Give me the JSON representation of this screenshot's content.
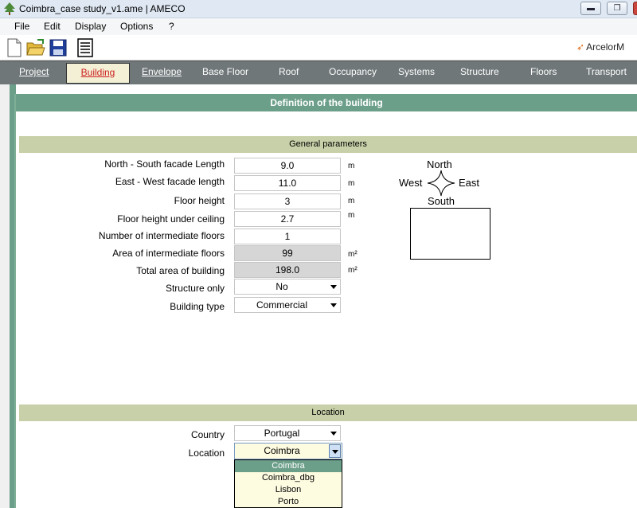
{
  "window": {
    "title": "Coimbra_case study_v1.ame | AMECO",
    "min": "▬",
    "max": "❐"
  },
  "menu": [
    "File",
    "Edit",
    "Display",
    "Options",
    "?"
  ],
  "toolbar": {
    "icons": [
      "new-document-icon",
      "open-folder-icon",
      "save-floppy-icon",
      "report-icon"
    ],
    "brand": "ArcelorM"
  },
  "tabs": {
    "active": "Building",
    "items": [
      "Project",
      "Building",
      "Envelope",
      "Base Floor",
      "Roof",
      "Occupancy",
      "Systems",
      "Structure",
      "Floors",
      "Transport"
    ]
  },
  "page": {
    "header": "Definition of the building",
    "general": {
      "title": "General parameters",
      "ns_label": "North - South facade Length",
      "ns_value": "9.0",
      "ns_unit": "m",
      "ew_label": "East - West facade length",
      "ew_value": "11.0",
      "ew_unit": "m",
      "fh_label": "Floor height",
      "fh_value": "3",
      "fh_unit": "m",
      "fhu_label": "Floor height under ceiling",
      "fhu_value": "2.7",
      "fhu_unit": "m",
      "nif_label": "Number of intermediate floors",
      "nif_value": "1",
      "aif_label": "Area of intermediate floors",
      "aif_value": "99",
      "aif_unit": "m²",
      "tab_label": "Total area of building",
      "tab_value": "198.0",
      "tab_unit": "m²",
      "so_label": "Structure only",
      "so_value": "No",
      "bt_label": "Building type",
      "bt_value": "Commercial"
    },
    "compass": {
      "north": "North",
      "south": "South",
      "east": "East",
      "west": "West"
    },
    "location": {
      "title": "Location",
      "country_label": "Country",
      "country_value": "Portugal",
      "location_label": "Location",
      "location_value": "Coimbra",
      "options": [
        "Coimbra",
        "Coimbra_dbg",
        "Lisbon",
        "Porto"
      ],
      "selected": "Coimbra"
    }
  },
  "colors": {
    "accent": "#6c9f8a",
    "section": "#c7d0a8",
    "tab_bg": "#6f7779",
    "active_tab_text": "#cc1e1e"
  }
}
